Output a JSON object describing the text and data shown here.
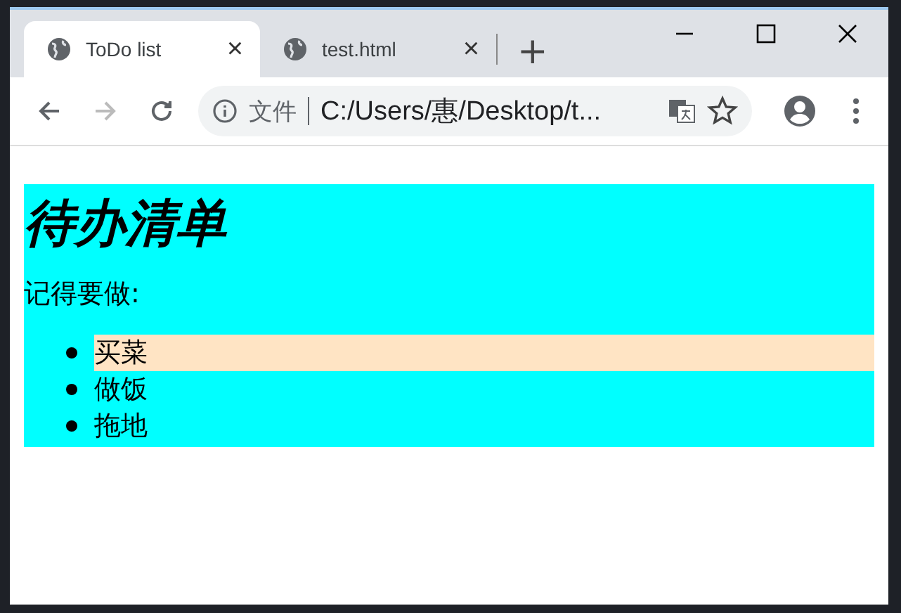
{
  "tabs": [
    {
      "title": "ToDo list",
      "selected": true,
      "close": "×"
    },
    {
      "title": "test.html",
      "selected": false,
      "close": "×"
    }
  ],
  "new_tab": "+",
  "toolbar": {
    "forward_disabled": true
  },
  "address_bar": {
    "scheme_label": "文件",
    "url": "C:/Users/惠/Desktop/t..."
  },
  "page": {
    "heading": "待办清单",
    "paragraph": "记得要做:",
    "items": [
      {
        "text": "买菜",
        "highlighted": true
      },
      {
        "text": "做饭",
        "highlighted": false
      },
      {
        "text": "拖地",
        "highlighted": false
      }
    ]
  }
}
